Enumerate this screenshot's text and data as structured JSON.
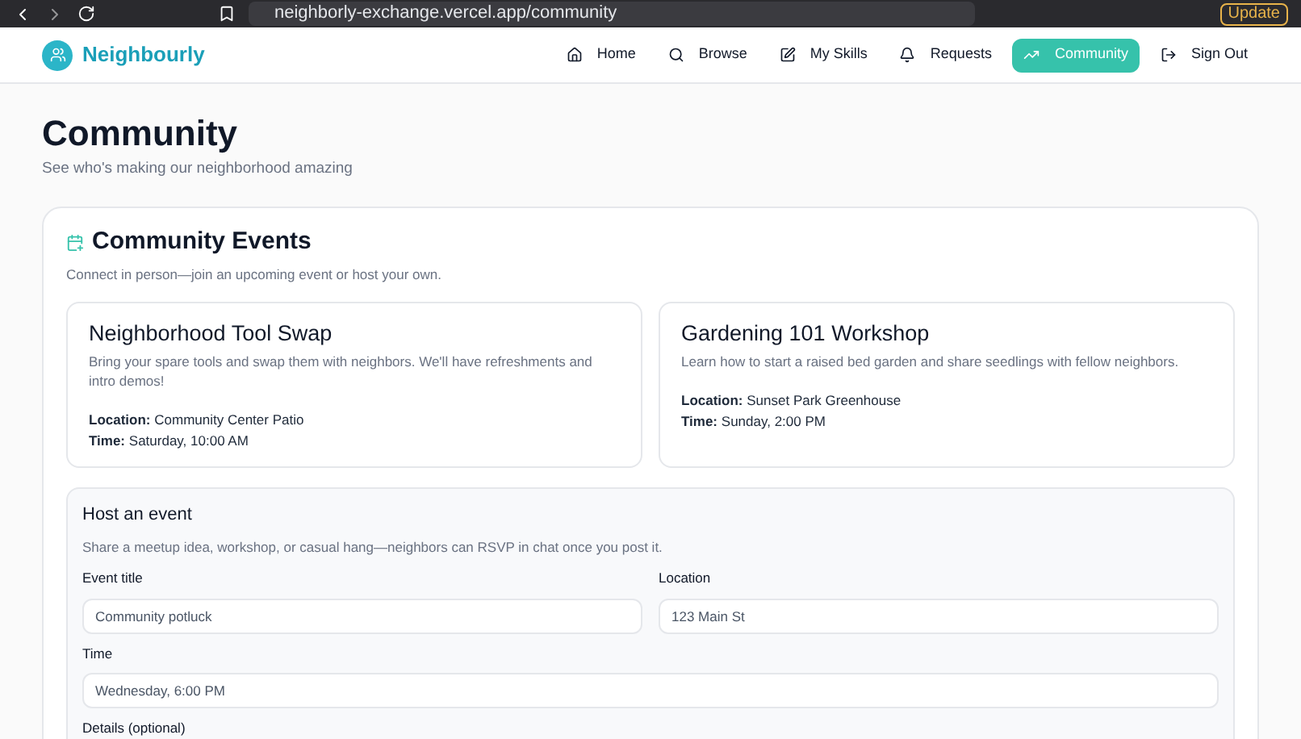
{
  "browser": {
    "url": "neighborly-exchange.vercel.app/community",
    "update_label": "Update"
  },
  "brand": {
    "name": "Neighbourly"
  },
  "nav": [
    {
      "label": "Home",
      "selected": false
    },
    {
      "label": "Browse",
      "selected": false
    },
    {
      "label": "My Skills",
      "selected": false
    },
    {
      "label": "Requests",
      "selected": false
    },
    {
      "label": "Community",
      "selected": true
    },
    {
      "label": "Sign Out",
      "selected": false
    }
  ],
  "page": {
    "title": "Community",
    "subtitle": "See who's making our neighborhood amazing"
  },
  "events_section": {
    "title": "Community Events",
    "subtitle": "Connect in person—join an upcoming event or host your own.",
    "events": [
      {
        "title": "Neighborhood Tool Swap",
        "description": "Bring your spare tools and swap them with neighbors. We'll have refreshments and intro demos!",
        "location_label": "Location:",
        "location": "Community Center Patio",
        "time_label": "Time:",
        "time": "Saturday, 10:00 AM"
      },
      {
        "title": "Gardening 101 Workshop",
        "description": "Learn how to start a raised bed garden and share seedlings with fellow neighbors.",
        "location_label": "Location:",
        "location": "Sunset Park Greenhouse",
        "time_label": "Time:",
        "time": "Sunday, 2:00 PM"
      }
    ]
  },
  "host_form": {
    "title": "Host an event",
    "subtitle": "Share a meetup idea, workshop, or casual hang—neighbors can RSVP in chat once you post it.",
    "fields": [
      {
        "label": "Event title",
        "placeholder": "Community potluck"
      },
      {
        "label": "Location",
        "placeholder": "123 Main St"
      },
      {
        "label": "Time",
        "placeholder": "Wednesday, 6:00 PM"
      }
    ],
    "details_label": "Details (optional)"
  }
}
